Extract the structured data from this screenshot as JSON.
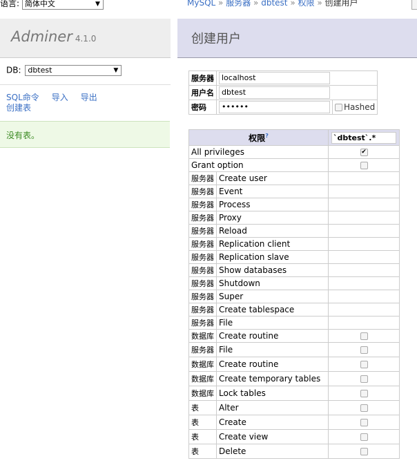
{
  "language": {
    "label": "语言:",
    "selected": "简体中文"
  },
  "logo": {
    "name": "Adminer",
    "version": "4.1.0"
  },
  "db": {
    "label": "DB:",
    "selected": "dbtest"
  },
  "links": {
    "sql": "SQL命令",
    "import": "导入",
    "export": "导出",
    "create_table": "创建表"
  },
  "no_tables": "没有表。",
  "breadcrumb": {
    "items": [
      "MySQL",
      "服务器",
      "dbtest",
      "权限"
    ],
    "separator": "»",
    "current": "创建用户"
  },
  "page_title": "创建用户",
  "form": {
    "server_label": "服务器",
    "server_value": "localhost",
    "username_label": "用户名",
    "username_value": "dbtest",
    "password_label": "密码",
    "password_value": "••••••",
    "hashed_label": "Hashed"
  },
  "privileges": {
    "header": "权限",
    "help": "?",
    "db_input": "`dbtest`.*",
    "rows": [
      {
        "context": "",
        "name": "All privileges",
        "checkbox": true,
        "checked": true
      },
      {
        "context": "",
        "name": "Grant option",
        "checkbox": true,
        "checked": false
      },
      {
        "context": "服务器",
        "name": "Create user",
        "checkbox": false,
        "checked": false
      },
      {
        "context": "服务器",
        "name": "Event",
        "checkbox": false,
        "checked": false
      },
      {
        "context": "服务器",
        "name": "Process",
        "checkbox": false,
        "checked": false
      },
      {
        "context": "服务器",
        "name": "Proxy",
        "checkbox": false,
        "checked": false
      },
      {
        "context": "服务器",
        "name": "Reload",
        "checkbox": false,
        "checked": false
      },
      {
        "context": "服务器",
        "name": "Replication client",
        "checkbox": false,
        "checked": false
      },
      {
        "context": "服务器",
        "name": "Replication slave",
        "checkbox": false,
        "checked": false
      },
      {
        "context": "服务器",
        "name": "Show databases",
        "checkbox": false,
        "checked": false
      },
      {
        "context": "服务器",
        "name": "Shutdown",
        "checkbox": false,
        "checked": false
      },
      {
        "context": "服务器",
        "name": "Super",
        "checkbox": false,
        "checked": false
      },
      {
        "context": "服务器",
        "name": "Create tablespace",
        "checkbox": false,
        "checked": false
      },
      {
        "context": "服务器",
        "name": "File",
        "checkbox": false,
        "checked": false
      },
      {
        "context": "数据库",
        "name": "Create routine",
        "checkbox": true,
        "checked": false
      },
      {
        "context": "服务器",
        "name": "File",
        "checkbox": true,
        "checked": false
      },
      {
        "context": "数据库",
        "name": "Create routine",
        "checkbox": true,
        "checked": false
      },
      {
        "context": "数据库",
        "name": "Create temporary tables",
        "checkbox": true,
        "checked": false
      },
      {
        "context": "数据库",
        "name": "Lock tables",
        "checkbox": true,
        "checked": false
      },
      {
        "context": "表",
        "name": "Alter",
        "checkbox": true,
        "checked": false
      },
      {
        "context": "表",
        "name": "Create",
        "checkbox": true,
        "checked": false
      },
      {
        "context": "表",
        "name": "Create view",
        "checkbox": true,
        "checked": false
      },
      {
        "context": "表",
        "name": "Delete",
        "checkbox": true,
        "checked": false
      }
    ]
  }
}
